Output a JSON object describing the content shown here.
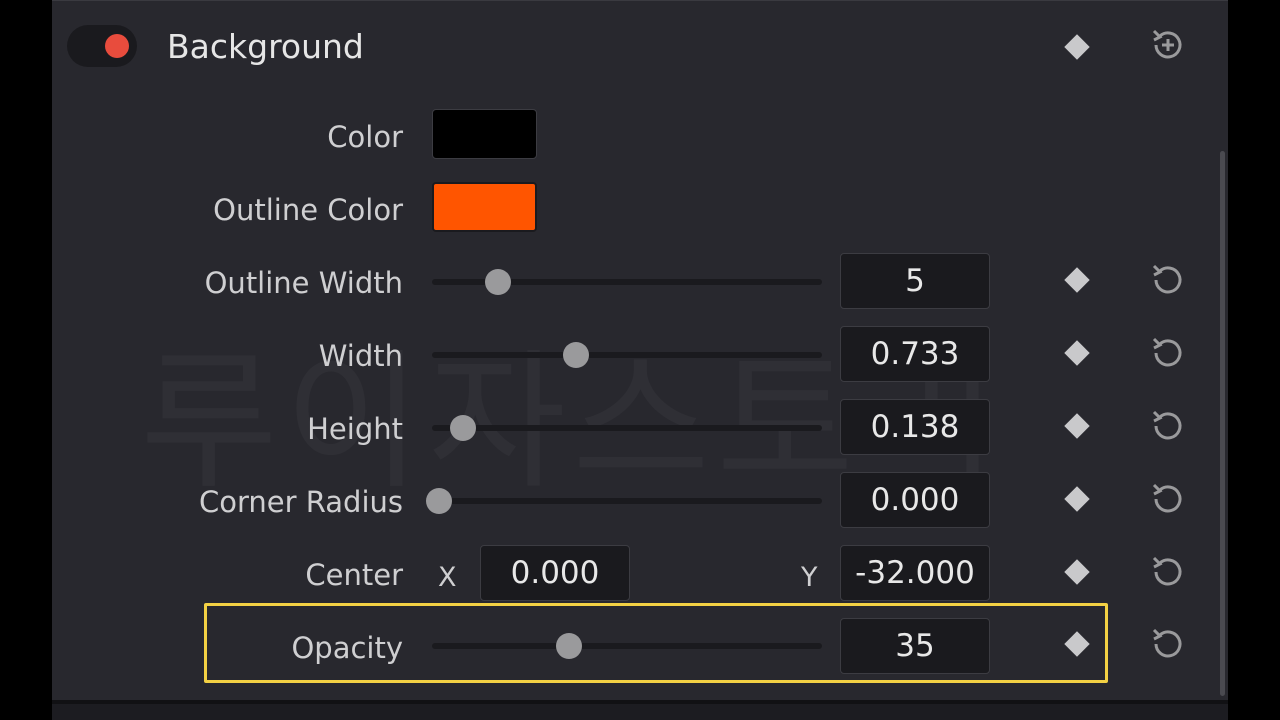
{
  "header": {
    "section_title": "Background",
    "toggle_enabled": true,
    "toggle_color": "#e84c3d",
    "keyframe_icon": "diamond-icon",
    "add_reset_icon": "reset-plus-icon"
  },
  "watermark": "루이자스토리",
  "properties": {
    "color": {
      "label": "Color",
      "value": "#000000"
    },
    "outline_color": {
      "label": "Outline Color",
      "value": "#ff5500"
    },
    "outline_width": {
      "label": "Outline Width",
      "value": "5",
      "slider_fraction": 0.17
    },
    "width": {
      "label": "Width",
      "value": "0.733",
      "slider_fraction": 0.37
    },
    "height": {
      "label": "Height",
      "value": "0.138",
      "slider_fraction": 0.08
    },
    "corner_radius": {
      "label": "Corner Radius",
      "value": "0.000",
      "slider_fraction": 0.0
    },
    "center": {
      "label": "Center",
      "x_label": "X",
      "x_value": "0.000",
      "y_label": "Y",
      "y_value": "-32.000"
    },
    "opacity": {
      "label": "Opacity",
      "value": "35",
      "slider_fraction": 0.35
    }
  },
  "highlight_color": "#f3d144",
  "icons": {
    "keyframe": "diamond-icon",
    "reset": "reset-icon"
  }
}
